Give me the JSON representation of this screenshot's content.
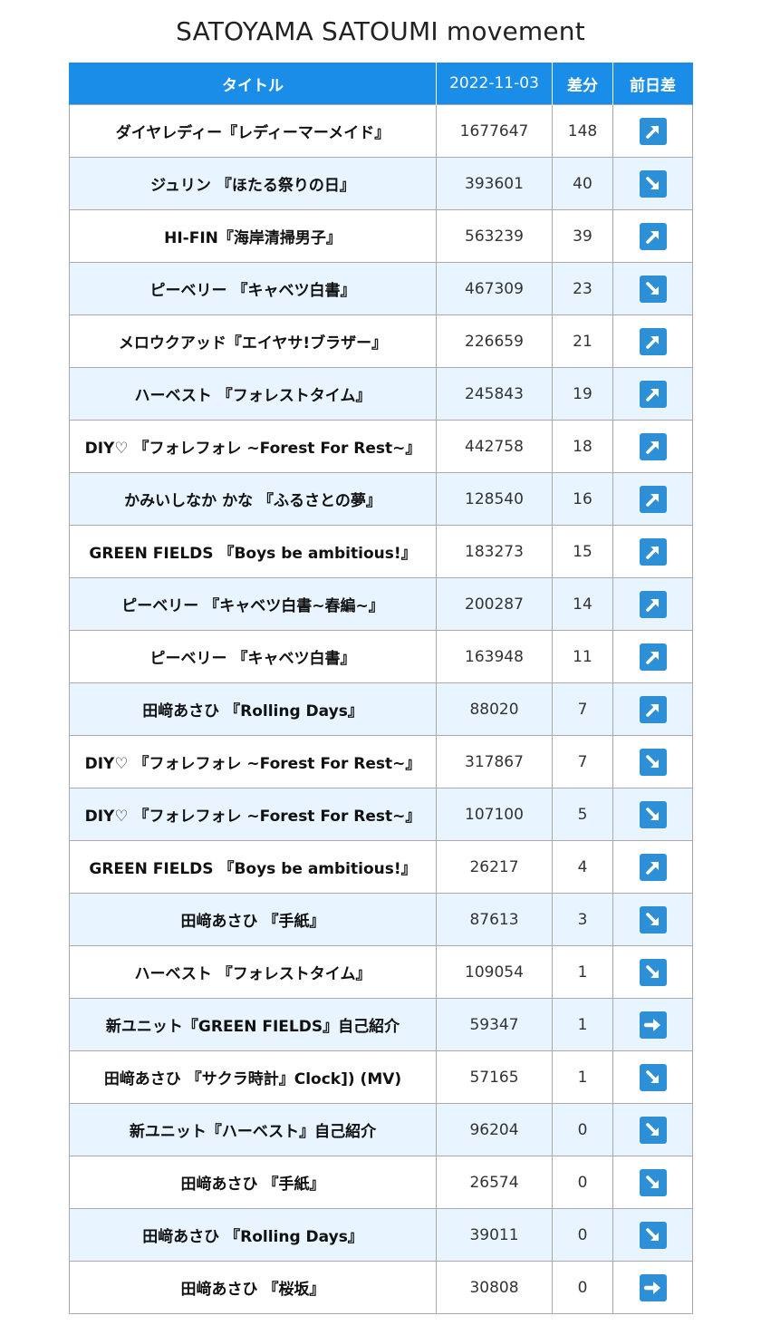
{
  "page": {
    "title": "SATOYAMA SATOUMI movement"
  },
  "table": {
    "headers": {
      "title": "タイトル",
      "date": "2022-11-03",
      "diff": "差分",
      "trend": "前日差"
    },
    "rows": [
      {
        "title": "ダイヤレディー『レディーマーメイド』",
        "count": "1677647",
        "diff": "148",
        "trend": "up-right-arrow-icon"
      },
      {
        "title": "ジュリン 『ほたる祭りの日』",
        "count": "393601",
        "diff": "40",
        "trend": "down-right-arrow-icon"
      },
      {
        "title": "HI-FIN『海岸清掃男子』",
        "count": "563239",
        "diff": "39",
        "trend": "up-right-arrow-icon"
      },
      {
        "title": "ピーベリー 『キャベツ白書』",
        "count": "467309",
        "diff": "23",
        "trend": "down-right-arrow-icon"
      },
      {
        "title": "メロウクアッド『エイヤサ!ブラザー』",
        "count": "226659",
        "diff": "21",
        "trend": "up-right-arrow-icon"
      },
      {
        "title": "ハーベスト 『フォレストタイム』",
        "count": "245843",
        "diff": "19",
        "trend": "up-right-arrow-icon"
      },
      {
        "title": "DIY♡ 『フォレフォレ ~Forest For Rest~』",
        "count": "442758",
        "diff": "18",
        "trend": "up-right-arrow-icon"
      },
      {
        "title": "かみいしなか かな 『ふるさとの夢』",
        "count": "128540",
        "diff": "16",
        "trend": "up-right-arrow-icon"
      },
      {
        "title": "GREEN FIELDS 『Boys be ambitious!』",
        "count": "183273",
        "diff": "15",
        "trend": "up-right-arrow-icon"
      },
      {
        "title": "ピーベリー 『キャベツ白書~春編~』",
        "count": "200287",
        "diff": "14",
        "trend": "up-right-arrow-icon"
      },
      {
        "title": "ピーベリー 『キャベツ白書』",
        "count": "163948",
        "diff": "11",
        "trend": "up-right-arrow-icon"
      },
      {
        "title": "田﨑あさひ 『Rolling Days』",
        "count": "88020",
        "diff": "7",
        "trend": "up-right-arrow-icon"
      },
      {
        "title": "DIY♡ 『フォレフォレ ~Forest For Rest~』",
        "count": "317867",
        "diff": "7",
        "trend": "down-right-arrow-icon"
      },
      {
        "title": "DIY♡ 『フォレフォレ ~Forest For Rest~』",
        "count": "107100",
        "diff": "5",
        "trend": "down-right-arrow-icon"
      },
      {
        "title": "GREEN FIELDS 『Boys be ambitious!』",
        "count": "26217",
        "diff": "4",
        "trend": "up-right-arrow-icon"
      },
      {
        "title": "田﨑あさひ 『手紙』",
        "count": "87613",
        "diff": "3",
        "trend": "down-right-arrow-icon"
      },
      {
        "title": "ハーベスト 『フォレストタイム』",
        "count": "109054",
        "diff": "1",
        "trend": "down-right-arrow-icon"
      },
      {
        "title": "新ユニット『GREEN FIELDS』自己紹介",
        "count": "59347",
        "diff": "1",
        "trend": "right-arrow-icon"
      },
      {
        "title": "田﨑あさひ 『サクラ時計』Clock]) (MV)",
        "count": "57165",
        "diff": "1",
        "trend": "down-right-arrow-icon"
      },
      {
        "title": "新ユニット『ハーベスト』自己紹介",
        "count": "96204",
        "diff": "0",
        "trend": "down-right-arrow-icon"
      },
      {
        "title": "田﨑あさひ 『手紙』",
        "count": "26574",
        "diff": "0",
        "trend": "down-right-arrow-icon"
      },
      {
        "title": "田﨑あさひ 『Rolling Days』",
        "count": "39011",
        "diff": "0",
        "trend": "down-right-arrow-icon"
      },
      {
        "title": "田﨑あさひ 『桜坂』",
        "count": "30808",
        "diff": "0",
        "trend": "right-arrow-icon"
      }
    ]
  },
  "colors": {
    "header_bg": "#1a8de8",
    "header_text": "#ffffff",
    "row_alt_bg": "#e8f4ff",
    "icon_bg": "#2d8fd6"
  }
}
